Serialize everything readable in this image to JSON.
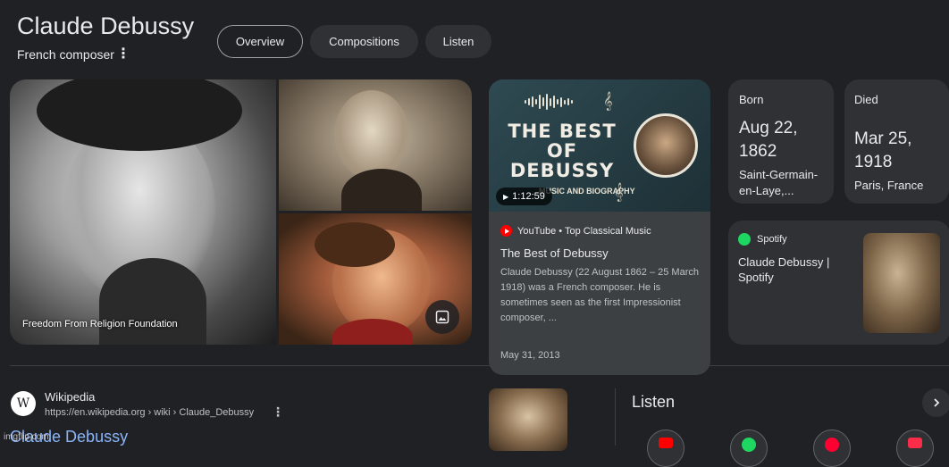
{
  "header": {
    "title": "Claude Debussy",
    "subtitle": "French composer",
    "tabs": [
      {
        "label": "Overview",
        "active": true
      },
      {
        "label": "Compositions",
        "active": false
      },
      {
        "label": "Listen",
        "active": false
      }
    ]
  },
  "images": {
    "credit": "Freedom From Religion Foundation",
    "more_images_icon": "image-icon"
  },
  "video": {
    "thumb_title": "THE BEST OF DEBUSSY",
    "thumb_subtitle": "MUSIC AND BIOGRAPHY",
    "duration": "1:12:59",
    "source": "YouTube • Top Classical Music",
    "title": "The Best of Debussy",
    "description": "Claude Debussy (22 August 1862 – 25 March 1918) was a French composer. He is sometimes seen as the first Impressionist composer, ...",
    "date": "May 31, 2013"
  },
  "born": {
    "label": "Born",
    "date_line1": "Aug 22,",
    "date_line2": "1862",
    "place_line1": "Saint-Germain-",
    "place_line2": "en-Laye,..."
  },
  "died": {
    "label": "Died",
    "date_line1": "Mar 25,",
    "date_line2": "1918",
    "place": "Paris, France"
  },
  "spotify": {
    "source": "Spotify",
    "title": "Claude Debussy | Spotify"
  },
  "wikipedia": {
    "icon_letter": "W",
    "name": "Wikipedia",
    "url": "https://en.wikipedia.org › wiki › Claude_Debussy",
    "link": "Claude Debussy"
  },
  "listen": {
    "heading": "Listen",
    "services": [
      {
        "name": "youtube-music",
        "color": "#ff0000"
      },
      {
        "name": "spotify",
        "color": "#1ed760"
      },
      {
        "name": "youtube",
        "color": "#ff0033"
      },
      {
        "name": "apple-music",
        "color": "#fa2d48"
      }
    ]
  },
  "watermark": "imgflip.com",
  "colors": {
    "background": "#202124",
    "card": "#303134",
    "link": "#8ab4f8"
  }
}
